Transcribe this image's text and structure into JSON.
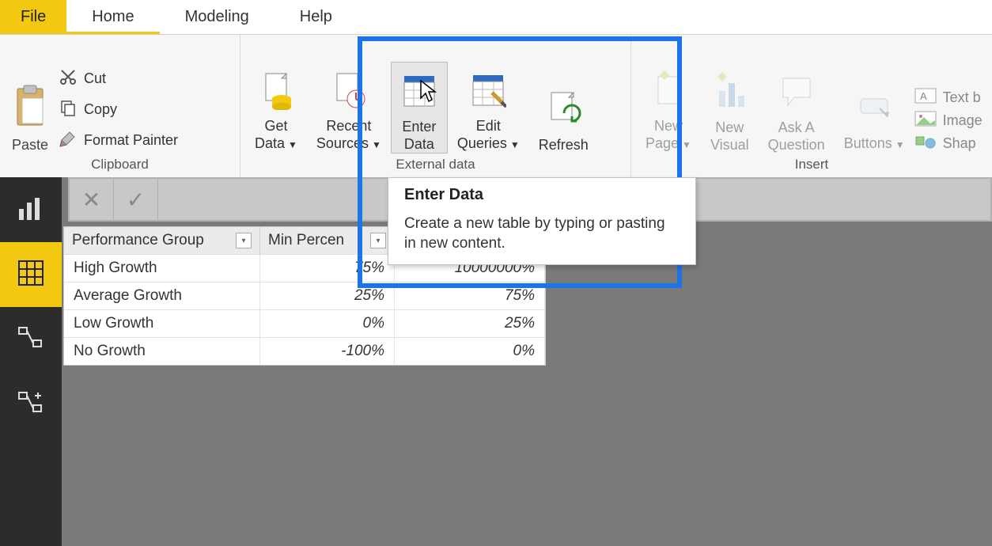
{
  "menu": {
    "file": "File",
    "home": "Home",
    "modeling": "Modeling",
    "help": "Help"
  },
  "ribbon": {
    "clipboard": {
      "group_label": "Clipboard",
      "paste": "Paste",
      "cut": "Cut",
      "copy": "Copy",
      "format_painter": "Format Painter"
    },
    "external": {
      "group_label": "External data",
      "get_data": "Get\nData",
      "recent_sources": "Recent\nSources",
      "enter_data": "Enter\nData",
      "edit_queries": "Edit\nQueries",
      "refresh": "Refresh"
    },
    "insert": {
      "group_label": "Insert",
      "new_page": "New\nPage",
      "new_visual": "New\nVisual",
      "ask_a_question": "Ask A\nQuestion",
      "buttons": "Buttons",
      "text_box": "Text b",
      "image": "Image",
      "shapes": "Shap"
    }
  },
  "tooltip": {
    "title": "Enter Data",
    "body": "Create a new table by typing or pasting in new content."
  },
  "table": {
    "columns": [
      "Performance Group",
      "Min Percen",
      ""
    ],
    "rows": [
      {
        "c0": "High Growth",
        "c1": "75%",
        "c2": "10000000%"
      },
      {
        "c0": "Average Growth",
        "c1": "25%",
        "c2": "75%"
      },
      {
        "c0": "Low Growth",
        "c1": "0%",
        "c2": "25%"
      },
      {
        "c0": "No Growth",
        "c1": "-100%",
        "c2": "0%"
      }
    ]
  }
}
